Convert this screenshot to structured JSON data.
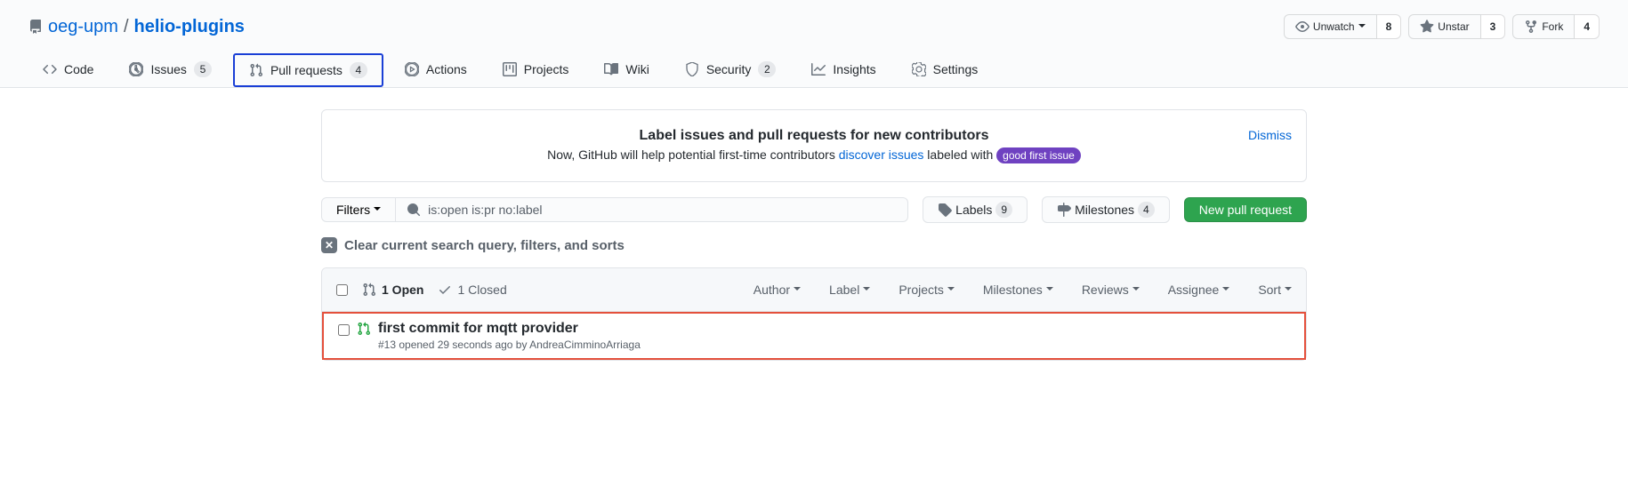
{
  "breadcrumb": {
    "owner": "oeg-upm",
    "repo": "helio-plugins"
  },
  "repo_buttons": {
    "unwatch": {
      "label": "Unwatch",
      "count": "8"
    },
    "unstar": {
      "label": "Unstar",
      "count": "3"
    },
    "fork": {
      "label": "Fork",
      "count": "4"
    }
  },
  "nav": {
    "code": "Code",
    "issues": {
      "label": "Issues",
      "count": "5"
    },
    "pulls": {
      "label": "Pull requests",
      "count": "4"
    },
    "actions": "Actions",
    "projects": "Projects",
    "wiki": "Wiki",
    "security": {
      "label": "Security",
      "count": "2"
    },
    "insights": "Insights",
    "settings": "Settings"
  },
  "notice": {
    "title": "Label issues and pull requests for new contributors",
    "prefix": "Now, GitHub will help potential first-time contributors ",
    "link": "discover issues",
    "suffix": " labeled with ",
    "pill": "good first issue",
    "dismiss": "Dismiss"
  },
  "toolbar": {
    "filters": "Filters",
    "search_value": "is:open is:pr no:label",
    "labels": {
      "label": "Labels",
      "count": "9"
    },
    "milestones": {
      "label": "Milestones",
      "count": "4"
    },
    "new_pr": "New pull request"
  },
  "clear": "Clear current search query, filters, and sorts",
  "list_header": {
    "open": "1 Open",
    "closed": "1 Closed",
    "filters": {
      "author": "Author",
      "label": "Label",
      "projects": "Projects",
      "milestones": "Milestones",
      "reviews": "Reviews",
      "assignee": "Assignee",
      "sort": "Sort"
    }
  },
  "pr": {
    "title": "first commit for mqtt provider",
    "meta": "#13 opened 29 seconds ago by AndreaCimminoArriaga"
  }
}
